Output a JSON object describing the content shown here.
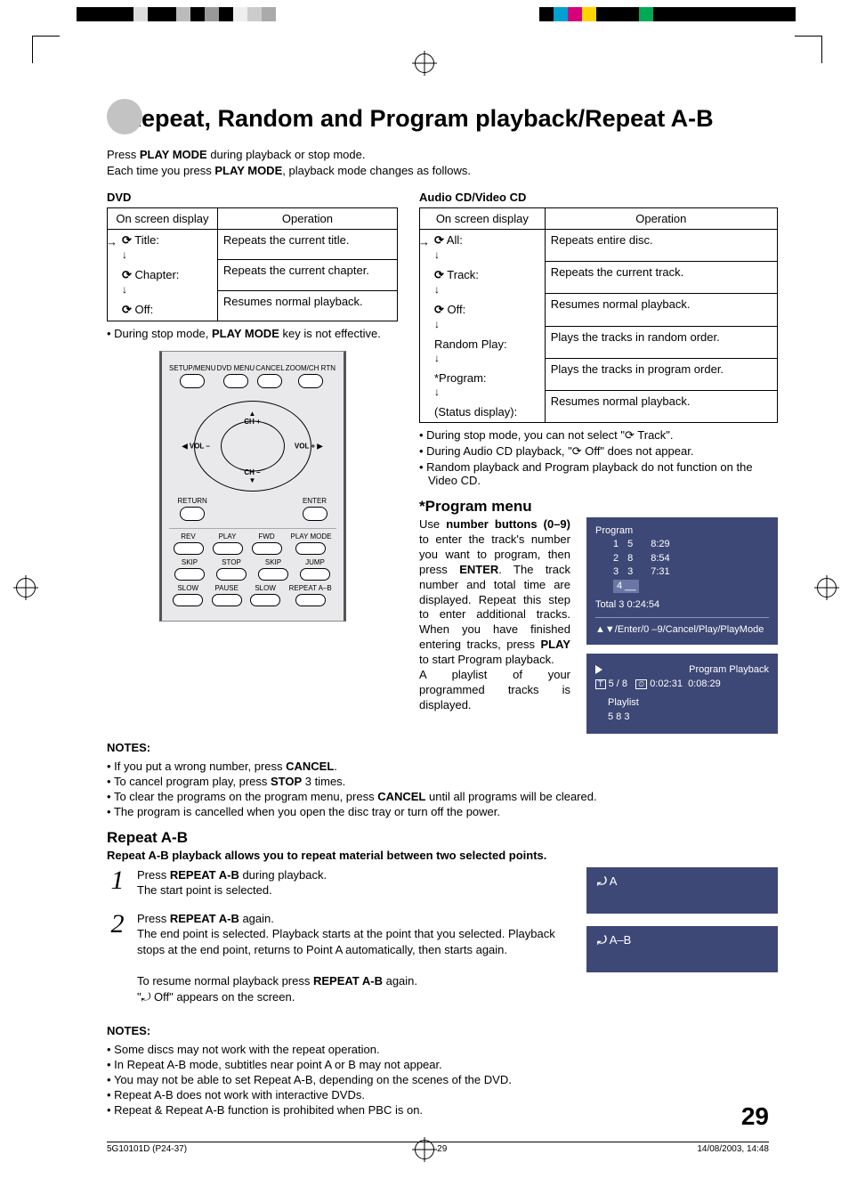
{
  "title": "Repeat, Random and Program playback/Repeat A-B",
  "intro_l1_a": "Press ",
  "intro_l1_b": "PLAY MODE",
  "intro_l1_c": " during playback or stop mode.",
  "intro_l2_a": "Each time you press ",
  "intro_l2_b": "PLAY MODE",
  "intro_l2_c": ", playback mode changes as follows.",
  "dvd": {
    "head": "DVD",
    "col1": "On screen display",
    "col2": "Operation",
    "rows": [
      {
        "osd": "Title:",
        "op": "Repeats the current title."
      },
      {
        "osd": "Chapter:",
        "op": "Repeats the current chapter."
      },
      {
        "osd": "Off:",
        "op": "Resumes normal playback."
      }
    ],
    "note": "During stop mode, PLAY MODE key is not effective."
  },
  "cd": {
    "head": "Audio CD/Video CD",
    "col1": "On screen display",
    "col2": "Operation",
    "rows": [
      {
        "osd": "All:",
        "op": "Repeats entire disc.",
        "icon": true
      },
      {
        "osd": "Track:",
        "op": "Repeats the current track.",
        "icon": true
      },
      {
        "osd": "Off:",
        "op": "Resumes normal playback.",
        "icon": true
      },
      {
        "osd": "Random Play:",
        "op": "Plays the tracks in random order.",
        "icon": false
      },
      {
        "osd": "*Program:",
        "op": "Plays the tracks in program order.",
        "icon": false
      },
      {
        "osd": "(Status display):",
        "op": "Resumes normal playback.",
        "icon": false
      }
    ],
    "notes": [
      "During stop mode, you can not select \"⟳ Track\".",
      "During Audio CD playback, \"⟳ Off\" does not appear.",
      "Random playback and Program playback do not function on the Video CD."
    ]
  },
  "remote": {
    "r1": [
      "SETUP/MENU",
      "DVD MENU",
      "CANCEL",
      "ZOOM/CH RTN"
    ],
    "nav": {
      "up": "CH +",
      "down": "CH –",
      "left": "VOL –",
      "right": "VOL +",
      "bl": "RETURN",
      "br": "ENTER"
    },
    "r2": [
      "REV",
      "PLAY",
      "FWD",
      "PLAY MODE"
    ],
    "r3": [
      "SKIP",
      "STOP",
      "SKIP",
      "JUMP"
    ],
    "r4": [
      "SLOW",
      "PAUSE",
      "SLOW",
      "REPEAT A–B"
    ]
  },
  "program": {
    "title": "*Program menu",
    "text_a": "Use ",
    "text_b": "number buttons (0–9)",
    "text_c": " to enter the track's number you want to program, then press ",
    "text_d": "ENTER",
    "text_e": ". The track number and total time are displayed. Repeat this step to enter additional tracks. When you have finished entering tracks, press ",
    "text_f": "PLAY",
    "text_g": " to start Program playback.",
    "text_h": "A playlist of your programmed tracks is displayed."
  },
  "program_box": {
    "title": "Program",
    "rows": [
      {
        "n": "1",
        "t": "5",
        "d": "8:29"
      },
      {
        "n": "2",
        "t": "8",
        "d": "8:54"
      },
      {
        "n": "3",
        "t": "3",
        "d": "7:31"
      }
    ],
    "entry": "4 __",
    "total": "Total 3   0:24:54",
    "hint": "▲▼/Enter/0 –9/Cancel/Play/PlayMode"
  },
  "status_box": {
    "title": "Program Playback",
    "line1a": "5 / 8",
    "line1b": "0:02:31",
    "line1c": "0:08:29",
    "pl": "Playlist",
    "nums": "5  8  3"
  },
  "notes1_label": "NOTES:",
  "notes1": [
    "If you put a wrong number, press CANCEL.",
    "To cancel program play, press STOP 3 times.",
    "To clear the programs on the program menu, press CANCEL until all programs will be cleared.",
    "The program is cancelled when you open the disc tray or turn off the power."
  ],
  "repeat_ab": {
    "title": "Repeat A-B",
    "sub": "Repeat A-B playback allows you to repeat material between two selected points.",
    "step1a": "Press ",
    "step1b": "REPEAT A-B",
    "step1c": " during playback.",
    "step1d": "The start point is selected.",
    "step2a": "Press ",
    "step2b": "REPEAT A-B",
    "step2c": " again.",
    "step2d": "The end point is selected. Playback starts at the point that you selected. Playback stops at the end point, returns to Point A automatically, then starts again.",
    "step2e_a": "To resume normal playback press ",
    "step2e_b": "REPEAT A-B",
    "step2e_c": " again.",
    "step2f": "\"⤾ Off\" appears on the screen.",
    "boxA": "A",
    "boxAB": "A–B"
  },
  "notes2_label": "NOTES:",
  "notes2": [
    "Some discs may not work with the repeat  operation.",
    "In Repeat A-B mode, subtitles near point A or B may not appear.",
    "You may not be able to set Repeat A-B, depending on the scenes of the DVD.",
    "Repeat A-B does not work with interactive DVDs.",
    "Repeat & Repeat A-B function is prohibited when PBC is on."
  ],
  "page_num": "29",
  "footer": {
    "l": "5G10101D (P24-37)",
    "c": "29",
    "r": "14/08/2003, 14:48"
  }
}
